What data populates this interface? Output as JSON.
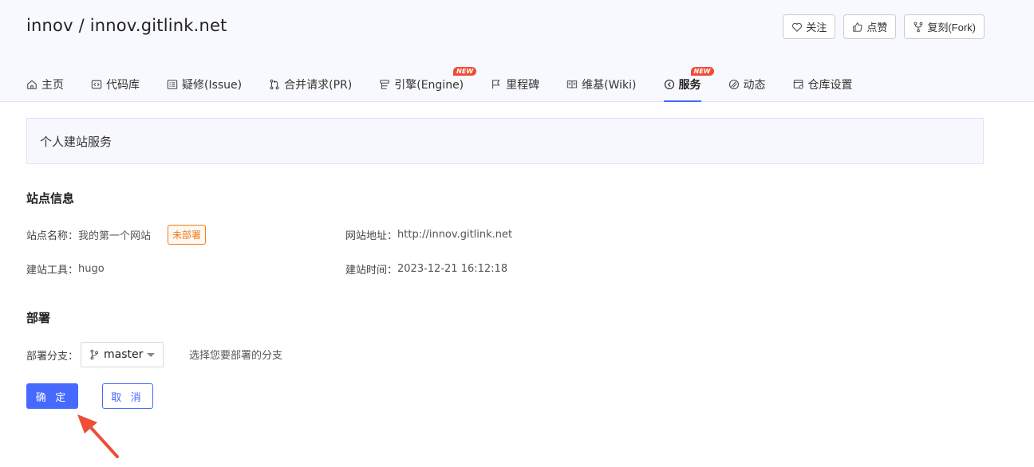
{
  "repo": {
    "title": "innov / innov.gitlink.net"
  },
  "actions": [
    {
      "id": "watch",
      "icon": "heart-icon",
      "label": "关注"
    },
    {
      "id": "like",
      "icon": "thumbs-up-icon",
      "label": "点赞"
    },
    {
      "id": "fork",
      "icon": "fork-icon",
      "label": "复刻(Fork)"
    }
  ],
  "tabs": [
    {
      "id": "home",
      "icon": "home-icon",
      "label": "主页",
      "new": false,
      "active": false
    },
    {
      "id": "code",
      "icon": "code-icon",
      "label": "代码库",
      "new": false,
      "active": false
    },
    {
      "id": "issue",
      "icon": "issue-icon",
      "label": "疑修(Issue)",
      "new": false,
      "active": false
    },
    {
      "id": "pr",
      "icon": "pull-request-icon",
      "label": "合并请求(PR)",
      "new": false,
      "active": false
    },
    {
      "id": "engine",
      "icon": "engine-icon",
      "label": "引擎(Engine)",
      "new": true,
      "active": false
    },
    {
      "id": "milestone",
      "icon": "flag-icon",
      "label": "里程碑",
      "new": false,
      "active": false
    },
    {
      "id": "wiki",
      "icon": "book-icon",
      "label": "维基(Wiki)",
      "new": false,
      "active": false
    },
    {
      "id": "service",
      "icon": "service-icon",
      "label": "服务",
      "new": true,
      "active": true
    },
    {
      "id": "activity",
      "icon": "activity-icon",
      "label": "动态",
      "new": false,
      "active": false
    },
    {
      "id": "settings",
      "icon": "settings-icon",
      "label": "仓库设置",
      "new": false,
      "active": false
    }
  ],
  "new_badge": "NEW",
  "panel": {
    "title": "个人建站服务"
  },
  "site_info": {
    "title": "站点信息",
    "name_label": "站点名称：",
    "name_value": "我的第一个网站",
    "status": "未部署",
    "url_label": "网站地址：",
    "url_value": "http://innov.gitlink.net",
    "tool_label": "建站工具：",
    "tool_value": "hugo",
    "time_label": "建站时间：",
    "time_value": "2023-12-21 16:12:18"
  },
  "deploy": {
    "title": "部署",
    "branch_label": "部署分支：",
    "branch_value": "master",
    "hint": "选择您要部署的分支",
    "confirm_label": "确 定",
    "cancel_label": "取 消"
  },
  "colors": {
    "accent": "#466aff",
    "new_badge": "#ee4d38",
    "status": "#ee7a1f",
    "annotation_arrow": "#ee4d38"
  }
}
